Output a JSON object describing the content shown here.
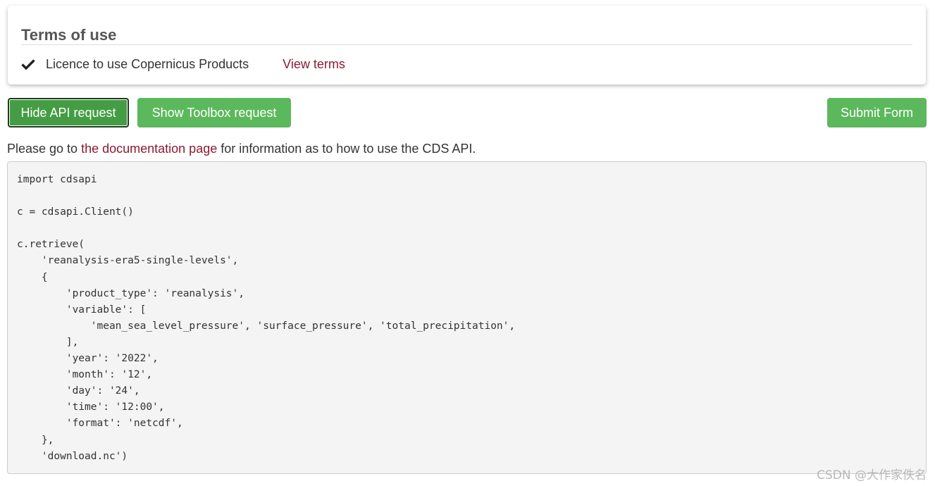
{
  "terms": {
    "title": "Terms of use",
    "licence_label": "Licence to use Copernicus Products",
    "view_terms_link": "View terms",
    "check_icon": "check-icon"
  },
  "buttons": {
    "hide_api": "Hide API request",
    "show_toolbox": "Show Toolbox request",
    "submit_form": "Submit Form"
  },
  "doc_line": {
    "prefix": "Please go to ",
    "link": "the documentation page",
    "suffix": " for information as to how to use the CDS API."
  },
  "code": "import cdsapi\n\nc = cdsapi.Client()\n\nc.retrieve(\n    'reanalysis-era5-single-levels',\n    {\n        'product_type': 'reanalysis',\n        'variable': [\n            'mean_sea_level_pressure', 'surface_pressure', 'total_precipitation',\n        ],\n        'year': '2022',\n        'month': '12',\n        'day': '24',\n        'time': '12:00',\n        'format': 'netcdf',\n    },\n    'download.nc')",
  "watermark": "CSDN @大作家佚名",
  "colors": {
    "button_green": "#5cb85c",
    "button_active": "#449d44",
    "link": "#8a1a32",
    "code_bg": "#f4f4f4"
  }
}
